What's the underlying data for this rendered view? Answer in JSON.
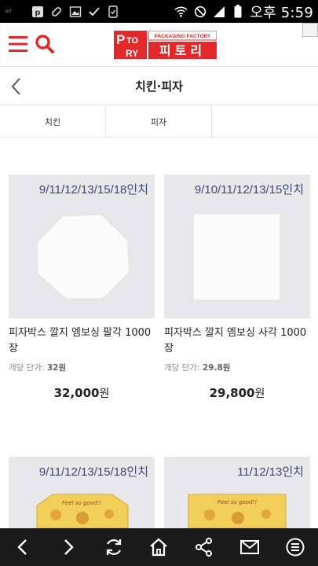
{
  "status_bar": {
    "carrier": "SKT",
    "time": "오후 5:59"
  },
  "header": {
    "logo_text": "피토리",
    "logo_sub": "PACKAGING FACTORY",
    "logo_letters": "PTORY"
  },
  "title_bar": {
    "title": "치킨·피자"
  },
  "tabs": [
    {
      "label": "치킨"
    },
    {
      "label": "피자"
    },
    {
      "label": ""
    }
  ],
  "products": [
    {
      "size_label": "9/11/12/13/15/18인치",
      "name": "피자박스 깔지 엠보싱 팔각 1000장",
      "unit_label": "개당 단가:",
      "unit_price": "32원",
      "price": "32,000",
      "currency": "원"
    },
    {
      "size_label": "9/10/11/12/13/15인치",
      "name": "피자박스 깔지 엠보싱 사각 1000장",
      "unit_label": "개당 단가:",
      "unit_price": "29.8원",
      "price": "29,800",
      "currency": "원"
    },
    {
      "size_label": "9/11/12/13/15/18인치",
      "box_text": "Feel so good!!"
    },
    {
      "size_label": "11/12/13인치",
      "box_text": "Feel so good!!"
    }
  ],
  "colors": {
    "brand_red": "#e2282a",
    "size_label": "#3e4773",
    "image_bg": "#e8e8ea"
  },
  "icons": [
    "menu-icon",
    "search-icon",
    "back-icon",
    "prev-icon",
    "next-icon",
    "refresh-icon",
    "home-icon",
    "share-icon",
    "mail-icon",
    "more-icon"
  ]
}
